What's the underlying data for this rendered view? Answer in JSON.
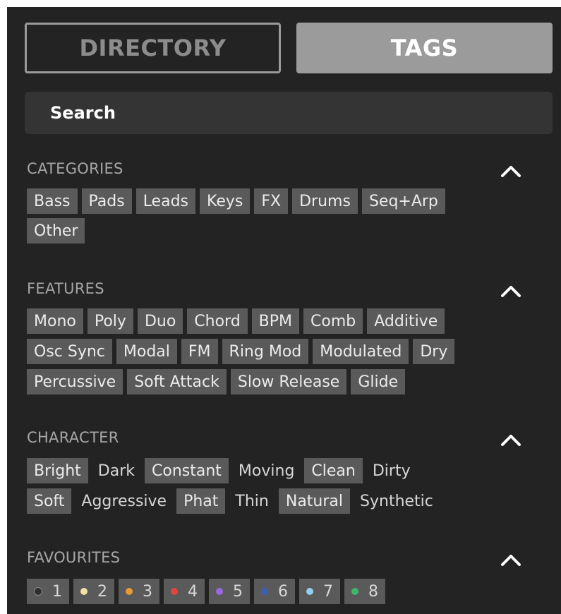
{
  "tabs": {
    "directory": "DIRECTORY",
    "tags": "TAGS",
    "active": "tags"
  },
  "search": {
    "label": "Search"
  },
  "sections": {
    "categories": {
      "title": "CATEGORIES",
      "rows": [
        [
          "Bass",
          "Pads",
          "Leads",
          "Keys",
          "FX",
          "Drums",
          "Seq+Arp"
        ],
        [
          "Other"
        ]
      ]
    },
    "features": {
      "title": "FEATURES",
      "rows": [
        [
          "Mono",
          "Poly",
          "Duo",
          "Chord",
          "BPM",
          "Comb",
          "Additive"
        ],
        [
          "Osc Sync",
          "Modal",
          "FM",
          "Ring Mod",
          "Modulated",
          "Dry"
        ],
        [
          "Percussive",
          "Soft Attack",
          "Slow Release",
          "Glide"
        ]
      ]
    },
    "character": {
      "title": "CHARACTER",
      "rows": [
        [
          {
            "label": "Bright",
            "selected": true
          },
          {
            "label": "Dark",
            "selected": false
          },
          {
            "label": "Constant",
            "selected": true
          },
          {
            "label": "Moving",
            "selected": false
          },
          {
            "label": "Clean",
            "selected": true
          },
          {
            "label": "Dirty",
            "selected": false
          }
        ],
        [
          {
            "label": "Soft",
            "selected": true
          },
          {
            "label": "Aggressive",
            "selected": false
          },
          {
            "label": "Phat",
            "selected": true
          },
          {
            "label": "Thin",
            "selected": false
          },
          {
            "label": "Natural",
            "selected": true
          },
          {
            "label": "Synthetic",
            "selected": false
          }
        ]
      ]
    },
    "favourites": {
      "title": "FAVOURITES",
      "items": [
        {
          "number": "1",
          "color": "#2e2e2e"
        },
        {
          "number": "2",
          "color": "#f2e3a0"
        },
        {
          "number": "3",
          "color": "#e99a3a"
        },
        {
          "number": "4",
          "color": "#e0463c"
        },
        {
          "number": "5",
          "color": "#9a67e0"
        },
        {
          "number": "6",
          "color": "#3a5fb0"
        },
        {
          "number": "7",
          "color": "#8fd0f0"
        },
        {
          "number": "8",
          "color": "#3fb66a"
        }
      ]
    }
  },
  "icons": {
    "collapse": "chevron-up-icon"
  },
  "colors": {
    "panel": "#232323",
    "tag_bg": "#5a5a5a",
    "active_tab": "#9b9b9b"
  }
}
